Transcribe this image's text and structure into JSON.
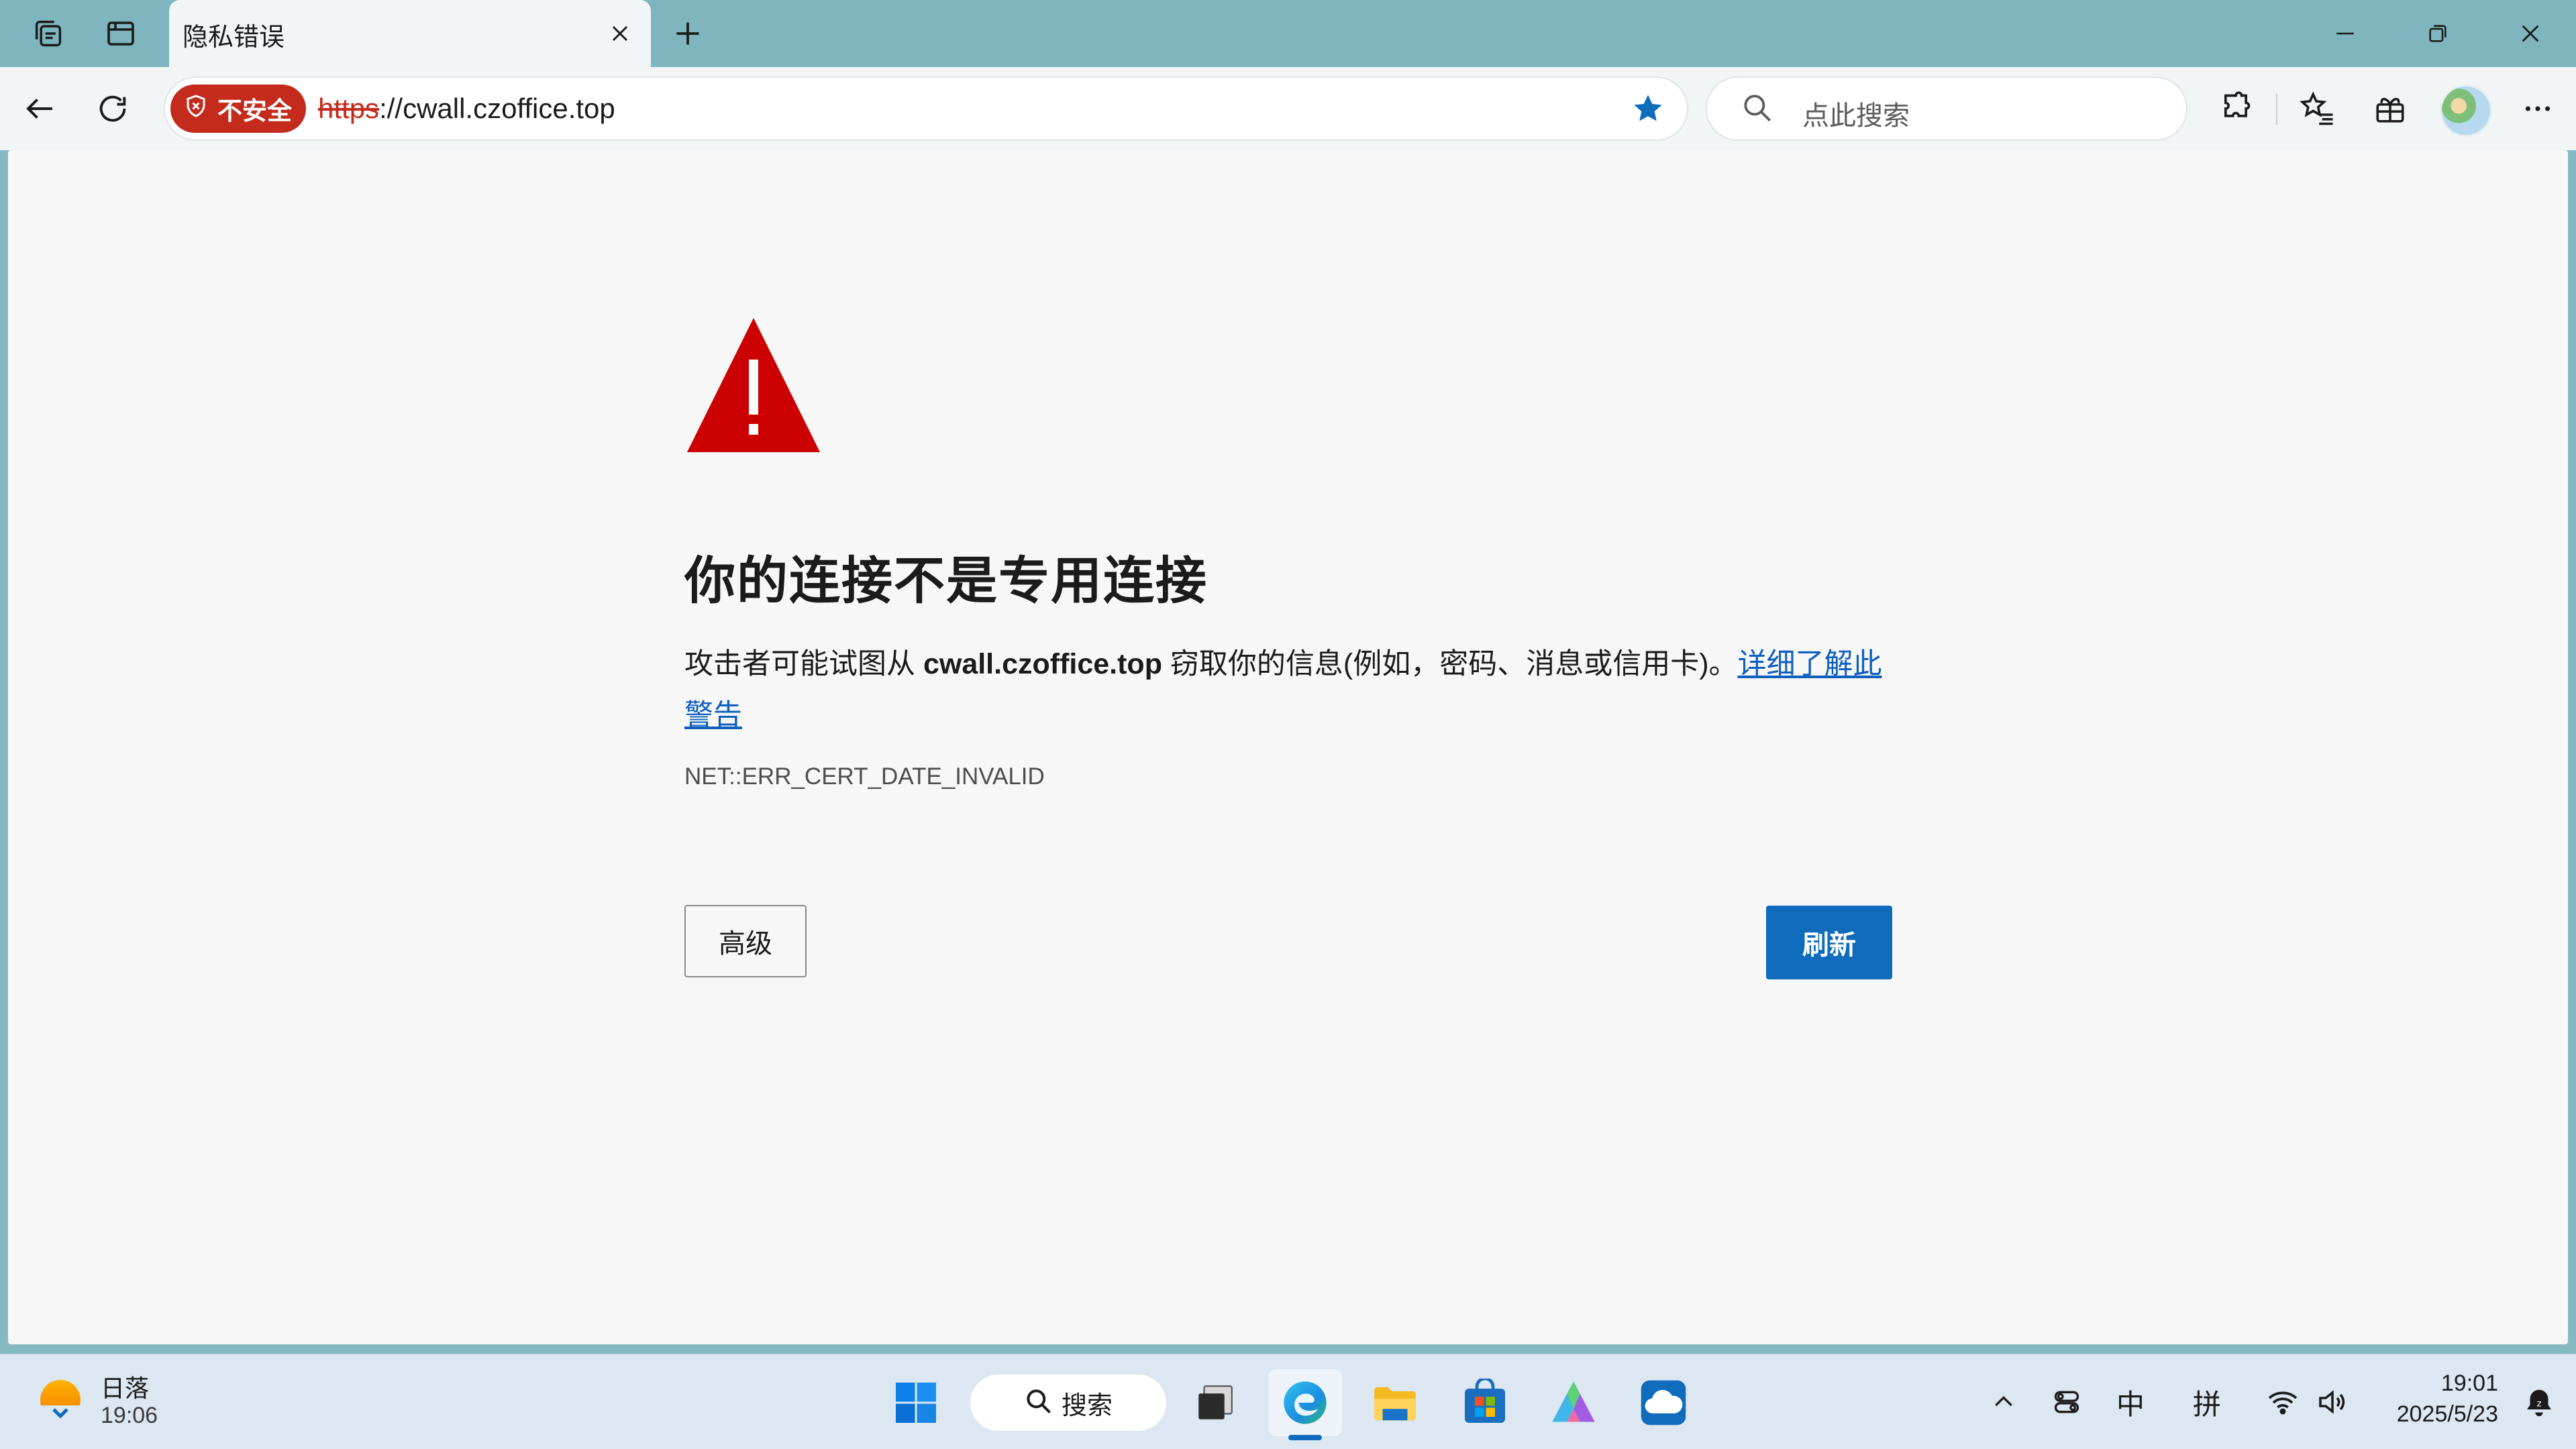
{
  "tab": {
    "title": "隐私错误"
  },
  "addressbar": {
    "security_label": "不安全",
    "url_scheme": "https",
    "url_rest": "://cwall.czoffice.top"
  },
  "search": {
    "placeholder": "点此搜索"
  },
  "error": {
    "heading": "你的连接不是专用连接",
    "desc_before": "攻击者可能试图从 ",
    "desc_host": "cwall.czoffice.top",
    "desc_after": " 窃取你的信息(例如，密码、消息或信用卡)。",
    "learn_more": "详细了解此警告",
    "code": "NET::ERR_CERT_DATE_INVALID",
    "advanced_label": "高级",
    "refresh_label": "刷新"
  },
  "taskbar": {
    "weather_title": "日落",
    "weather_time": "19:06",
    "search_label": "搜索",
    "ime_lang": "中",
    "ime_mode": "拼",
    "time": "19:01",
    "date": "2025/5/23"
  },
  "colors": {
    "accent": "#0f6cbd",
    "danger": "#c42b1c",
    "warning_triangle": "#cc0000"
  },
  "icons": [
    "workspaces-icon",
    "tab-actions-icon",
    "close-icon",
    "plus-icon",
    "minimize-icon",
    "restore-icon",
    "back-arrow-icon",
    "refresh-icon",
    "shield-icon",
    "star-icon",
    "search-icon",
    "extensions-icon",
    "favorites-icon",
    "collections-icon",
    "more-icon",
    "warning-icon",
    "windows-start-icon",
    "task-view-icon",
    "edge-icon",
    "file-explorer-icon",
    "store-icon",
    "copilot-icon",
    "onedrive-icon",
    "chevron-up-icon",
    "wifi-icon",
    "volume-icon",
    "bell-icon"
  ]
}
